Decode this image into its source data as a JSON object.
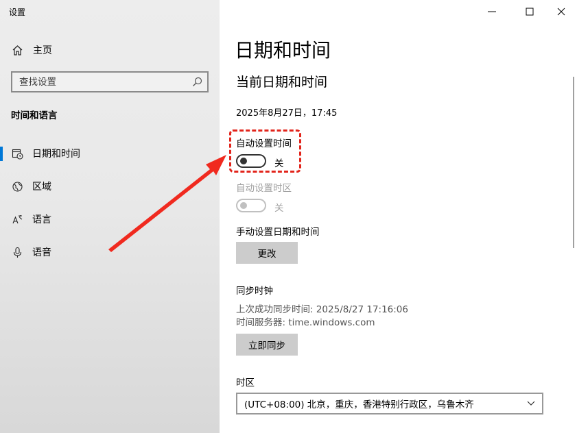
{
  "window": {
    "title": "设置",
    "controls": [
      "minimize",
      "maximize",
      "close"
    ]
  },
  "sidebar": {
    "home_label": "主页",
    "search_placeholder": "查找设置",
    "section_title": "时间和语言",
    "items": [
      {
        "label": "日期和时间",
        "icon": "clock-calendar-icon",
        "active": true
      },
      {
        "label": "区域",
        "icon": "globe-icon",
        "active": false
      },
      {
        "label": "语言",
        "icon": "language-icon",
        "active": false
      },
      {
        "label": "语音",
        "icon": "microphone-icon",
        "active": false
      }
    ]
  },
  "main": {
    "title": "日期和时间",
    "subtitle": "当前日期和时间",
    "current_datetime": "2025年8月27日，17:45",
    "auto_time": {
      "label": "自动设置时间",
      "state": "关"
    },
    "auto_timezone": {
      "label": "自动设置时区",
      "state": "关"
    },
    "manual": {
      "label": "手动设置日期和时间",
      "button": "更改"
    },
    "sync": {
      "title": "同步时钟",
      "last_sync": "上次成功同步时间: 2025/8/27 17:16:06",
      "server": "时间服务器: time.windows.com",
      "button": "立即同步"
    },
    "timezone": {
      "label": "时区",
      "selected": "(UTC+08:00) 北京，重庆，香港特别行政区，乌鲁木齐"
    }
  },
  "colors": {
    "accent": "#0078d7",
    "highlight": "#e2241b"
  }
}
